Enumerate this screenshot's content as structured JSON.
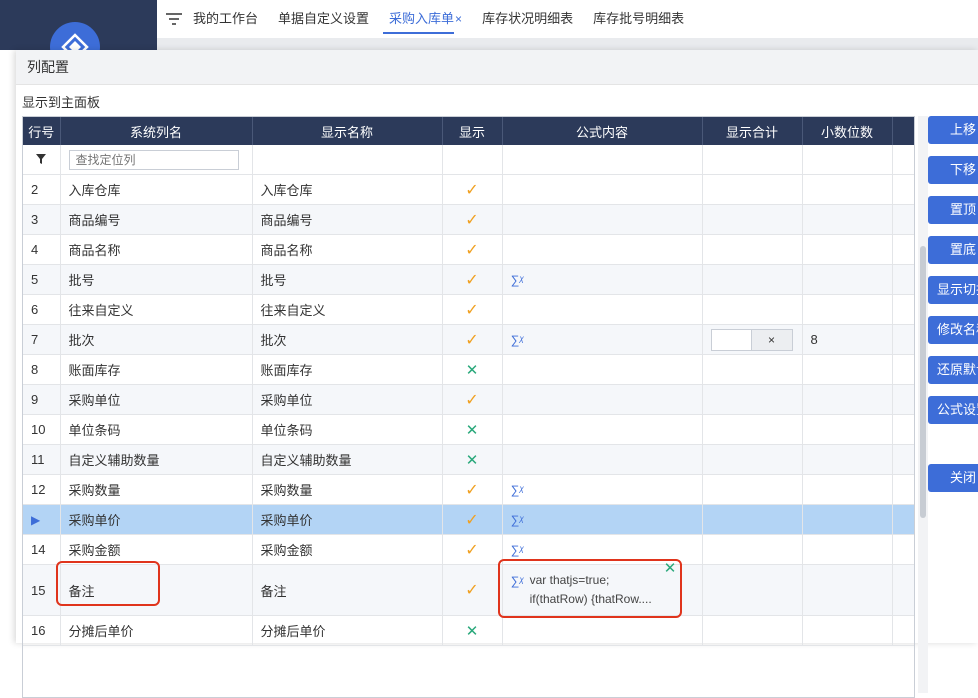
{
  "app": {
    "tabs": [
      {
        "label": "我的工作台"
      },
      {
        "label": "单据自定义设置"
      },
      {
        "label": "采购入库单"
      },
      {
        "label": "库存状况明细表"
      },
      {
        "label": "库存批号明细表"
      }
    ],
    "tab_close": "×"
  },
  "dialog": {
    "title": "列配置",
    "section_label": "显示到主面板",
    "filter_placeholder": "查找定位列",
    "columns": [
      "行号",
      "系统列名",
      "显示名称",
      "显示",
      "公式内容",
      "显示合计",
      "小数位数"
    ],
    "rows": [
      {
        "no": "2",
        "sys": "入库仓库",
        "disp": "入库仓库",
        "show": "check",
        "formula": false
      },
      {
        "no": "3",
        "sys": "商品编号",
        "disp": "商品编号",
        "show": "check",
        "formula": false
      },
      {
        "no": "4",
        "sys": "商品名称",
        "disp": "商品名称",
        "show": "check",
        "formula": false
      },
      {
        "no": "5",
        "sys": "批号",
        "disp": "批号",
        "show": "check",
        "formula": true
      },
      {
        "no": "6",
        "sys": "往来自定义",
        "disp": "往来自定义",
        "show": "check",
        "formula": false
      },
      {
        "no": "7",
        "sys": "批次",
        "disp": "批次",
        "show": "check",
        "formula": true,
        "sum": "×",
        "decimals": "8"
      },
      {
        "no": "8",
        "sys": "账面库存",
        "disp": "账面库存",
        "show": "cross",
        "formula": false
      },
      {
        "no": "9",
        "sys": "采购单位",
        "disp": "采购单位",
        "show": "check",
        "formula": false
      },
      {
        "no": "10",
        "sys": "单位条码",
        "disp": "单位条码",
        "show": "cross",
        "formula": false
      },
      {
        "no": "11",
        "sys": "自定义辅助数量",
        "disp": "自定义辅助数量",
        "show": "cross",
        "formula": false
      },
      {
        "no": "12",
        "sys": "采购数量",
        "disp": "采购数量",
        "show": "check",
        "formula": true
      },
      {
        "no": "▶",
        "sys": "采购单价",
        "disp": "采购单价",
        "show": "check",
        "formula": true
      },
      {
        "no": "14",
        "sys": "采购金额",
        "disp": "采购金额",
        "show": "check",
        "formula": true
      },
      {
        "no": "15",
        "sys": "备注",
        "disp": "备注",
        "show": "check",
        "formula": true,
        "formula_text_1": "var thatjs=true;",
        "formula_text_2": "if(thatRow) {thatRow....",
        "formula_flag": "cross"
      },
      {
        "no": "16",
        "sys": "分摊后单价",
        "disp": "分摊后单价",
        "show": "cross",
        "formula": false
      }
    ],
    "buttons": [
      "上移",
      "下移",
      "置顶",
      "置底",
      "显示切换",
      "修改名称",
      "还原默认",
      "公式设置",
      "关闭"
    ]
  },
  "colors": {
    "header_bg": "#2c3a5a",
    "accent": "#3d6dd8",
    "check": "#f0a020",
    "cross": "#2aa87b",
    "selected_row": "#b3d4f5",
    "highlight_box": "#e0341c"
  }
}
